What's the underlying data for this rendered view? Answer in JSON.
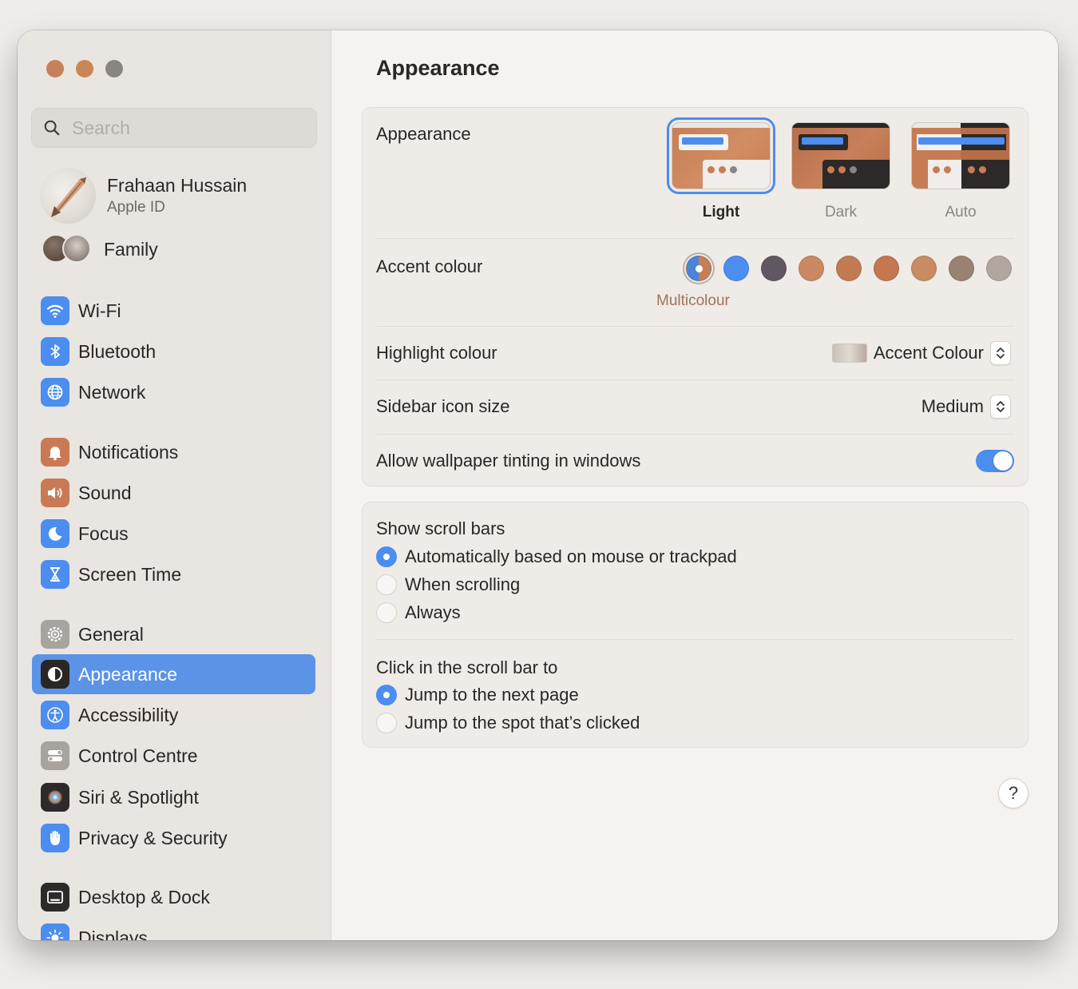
{
  "sidebar": {
    "search_placeholder": "Search",
    "profile": {
      "name": "Frahaan Hussain",
      "subtitle": "Apple ID"
    },
    "family_label": "Family",
    "items": [
      {
        "label": "Wi-Fi",
        "icon": "wifi-icon",
        "color": "#4c8df0"
      },
      {
        "label": "Bluetooth",
        "icon": "bluetooth-icon",
        "color": "#4c8df0"
      },
      {
        "label": "Network",
        "icon": "globe-icon",
        "color": "#4c8df0"
      },
      {
        "label": "Notifications",
        "icon": "bell-icon",
        "color": "#c97a55"
      },
      {
        "label": "Sound",
        "icon": "speaker-icon",
        "color": "#c97a55"
      },
      {
        "label": "Focus",
        "icon": "moon-icon",
        "color": "#4c8df0"
      },
      {
        "label": "Screen Time",
        "icon": "hourglass-icon",
        "color": "#4c8df0"
      },
      {
        "label": "General",
        "icon": "gear-icon",
        "color": "#a9a39e"
      },
      {
        "label": "Appearance",
        "icon": "appearance-icon",
        "color": "#2a2624",
        "selected": true
      },
      {
        "label": "Accessibility",
        "icon": "accessibility-icon",
        "color": "#4c8df0"
      },
      {
        "label": "Control Centre",
        "icon": "toggles-icon",
        "color": "#a9a39e"
      },
      {
        "label": "Siri & Spotlight",
        "icon": "siri-icon",
        "color": "#2d2a2a"
      },
      {
        "label": "Privacy & Security",
        "icon": "hand-icon",
        "color": "#4c8df0"
      },
      {
        "label": "Desktop & Dock",
        "icon": "dock-icon",
        "color": "#2d2a2a"
      },
      {
        "label": "Displays",
        "icon": "sun-icon",
        "color": "#4c8df0"
      }
    ]
  },
  "main": {
    "title": "Appearance",
    "appearance": {
      "label": "Appearance",
      "options": [
        {
          "label": "Light",
          "selected": true
        },
        {
          "label": "Dark",
          "selected": false
        },
        {
          "label": "Auto",
          "selected": false
        }
      ]
    },
    "accent": {
      "label": "Accent colour",
      "selected_label": "Multicolour",
      "swatches": [
        "multicolour",
        "#4c8df0",
        "#615762",
        "#c88963",
        "#c27a52",
        "#c5774f",
        "#c98b62",
        "#9a8273",
        "#b3a69f"
      ]
    },
    "highlight": {
      "label": "Highlight colour",
      "value": "Accent Colour"
    },
    "sidebar_icon_size": {
      "label": "Sidebar icon size",
      "value": "Medium"
    },
    "wallpaper_tinting": {
      "label": "Allow wallpaper tinting in windows",
      "enabled": true
    },
    "scroll_bars": {
      "title": "Show scroll bars",
      "options": [
        {
          "label": "Automatically based on mouse or trackpad",
          "selected": true
        },
        {
          "label": "When scrolling",
          "selected": false
        },
        {
          "label": "Always",
          "selected": false
        }
      ]
    },
    "click_scroll": {
      "title": "Click in the scroll bar to",
      "options": [
        {
          "label": "Jump to the next page",
          "selected": true
        },
        {
          "label": "Jump to the spot that’s clicked",
          "selected": false
        }
      ]
    },
    "help_label": "?"
  }
}
